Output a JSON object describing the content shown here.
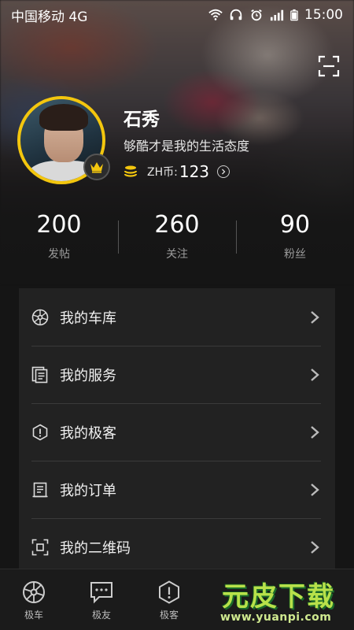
{
  "status_bar": {
    "carrier": "中国移动 4G",
    "time": "15:00"
  },
  "profile": {
    "name": "石秀",
    "bio": "够酷才是我的生活态度",
    "coin_label": "ZH币:",
    "coin_value": "123"
  },
  "stats": [
    {
      "value": "200",
      "label": "发帖"
    },
    {
      "value": "260",
      "label": "关注"
    },
    {
      "value": "90",
      "label": "粉丝"
    }
  ],
  "menu": [
    {
      "label": "我的车库",
      "icon": "wheel-icon"
    },
    {
      "label": "我的服务",
      "icon": "document-icon"
    },
    {
      "label": "我的极客",
      "icon": "hexagon-info-icon"
    },
    {
      "label": "我的订单",
      "icon": "order-icon"
    },
    {
      "label": "我的二维码",
      "icon": "qrcode-icon"
    }
  ],
  "tabs": [
    {
      "label": "极车",
      "icon": "wheel-icon"
    },
    {
      "label": "极友",
      "icon": "chat-icon"
    },
    {
      "label": "极客",
      "icon": "hexagon-info-icon"
    }
  ],
  "watermark": {
    "brand": "元皮下载",
    "url": "www.yuanpi.com"
  },
  "colors": {
    "accent": "#f3c60e",
    "background": "#151515",
    "card": "#222222",
    "watermark_green": "#b7e14a"
  }
}
